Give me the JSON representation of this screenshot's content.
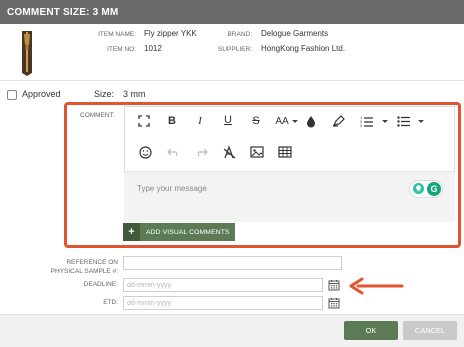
{
  "dialog": {
    "title": "COMMENT SIZE: 3 MM"
  },
  "item": {
    "name_label": "ITEM NAME:",
    "name_value": "Fly zipper YKK",
    "no_label": "ITEM NO:",
    "no_value": "1012",
    "brand_label": "BRAND:",
    "brand_value": "Delogue Garments",
    "supplier_label": "SUPPLIER:",
    "supplier_value": "HongKong Fashion Ltd."
  },
  "approval": {
    "approved_label": "Approved",
    "approved_checked": false
  },
  "size": {
    "label": "Size:",
    "value": "3 mm"
  },
  "comment": {
    "label": "COMMENT:",
    "placeholder": "Type your message",
    "visual_plus": "+",
    "visual_button": "ADD VISUAL COMMENTS",
    "grammarly_letter": "G"
  },
  "toolbar": {
    "row1": [
      "fullscreen-icon",
      "bold-icon",
      "italic-icon",
      "underline-icon",
      "strikethrough-icon",
      "font-size-icon",
      "text-color-icon",
      "highlight-icon",
      "ordered-list-icon",
      "unordered-list-icon"
    ],
    "row2": [
      "emoji-icon",
      "undo-icon",
      "redo-icon",
      "clear-format-icon",
      "image-icon",
      "table-icon"
    ]
  },
  "fields": {
    "reference_label_1": "REFERENCE ON",
    "reference_label_2": "PHYSICAL SAMPLE #:",
    "reference_value": "",
    "deadline_label": "DEADLINE:",
    "deadline_placeholder": "dd-mmm-yyyy",
    "etd_label": "ETD:",
    "etd_placeholder": "dd-mmm-yyyy"
  },
  "footer": {
    "ok": "OK",
    "cancel": "CANCEL"
  },
  "colors": {
    "title_bar": "#6a6a6a",
    "accent_green": "#5c7a56",
    "highlight_red": "#e0542f",
    "grammarly_green": "#15a57a"
  }
}
